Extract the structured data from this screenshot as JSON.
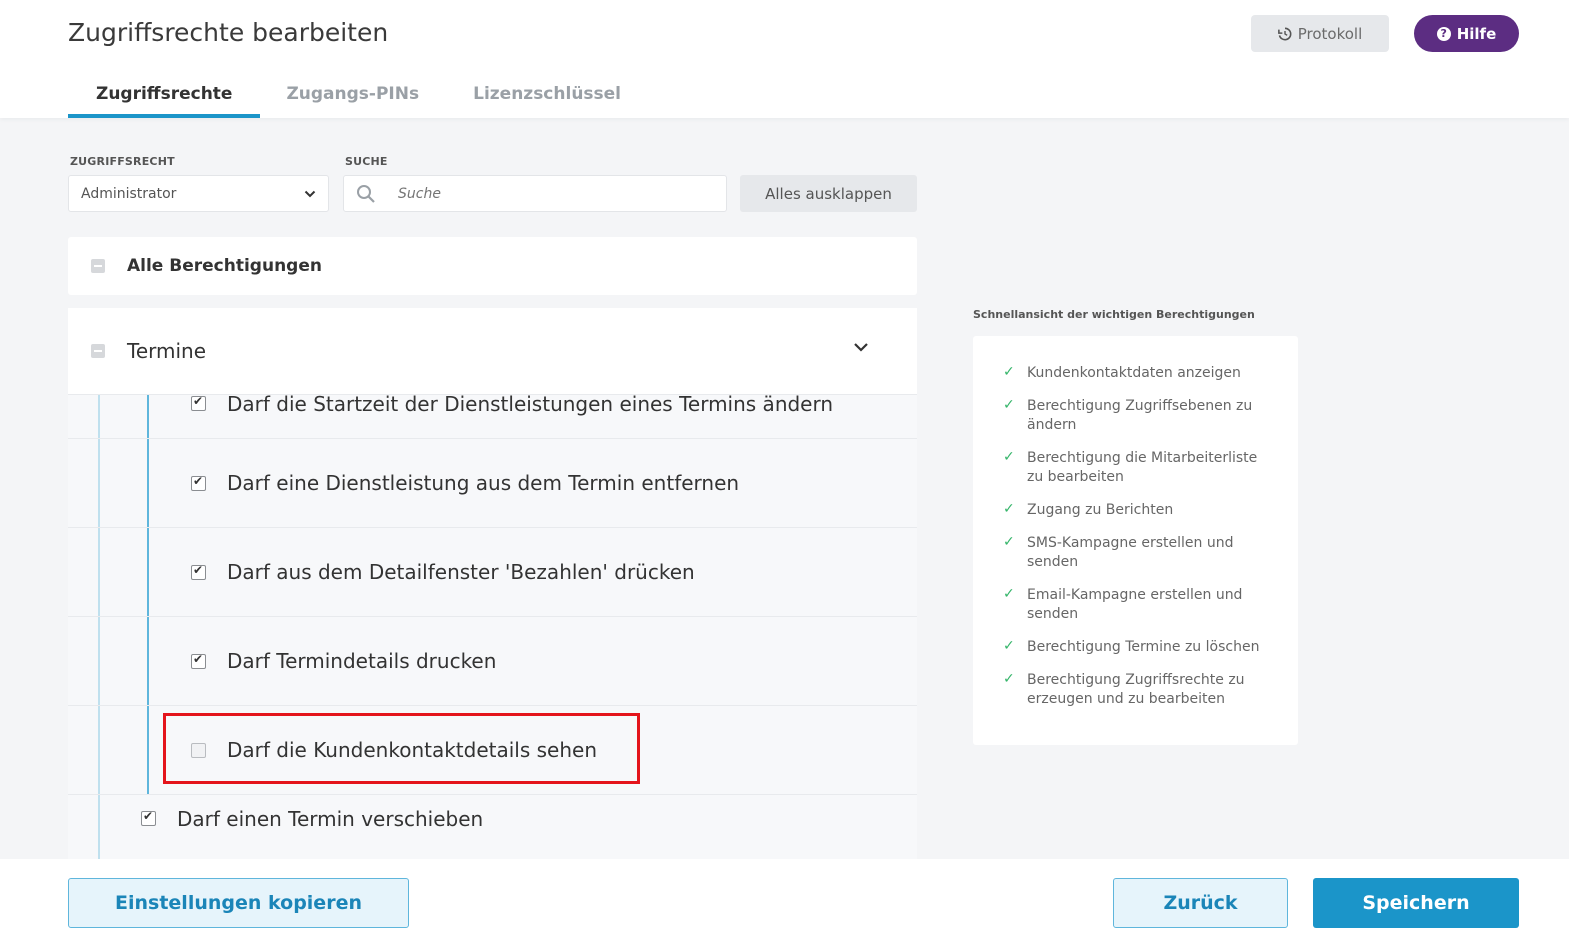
{
  "header": {
    "title": "Zugriffsrechte bearbeiten",
    "protokoll_label": "Protokoll",
    "hilfe_label": "Hilfe",
    "tabs": [
      "Zugriffsrechte",
      "Zugangs-PINs",
      "Lizenzschlüssel"
    ]
  },
  "filters": {
    "role_label": "ZUGRIFFSRECHT",
    "role_value": "Administrator",
    "search_label": "SUCHE",
    "search_placeholder": "Suche",
    "expand_all_label": "Alles ausklappen"
  },
  "permissions": {
    "all_label": "Alle Berechtigungen",
    "group_label": "Termine",
    "rows": [
      {
        "label": "Darf die Startzeit der Dienstleistungen eines Termins ändern",
        "checked": true
      },
      {
        "label": "Darf eine Dienstleistung aus dem Termin entfernen",
        "checked": true
      },
      {
        "label": "Darf aus dem Detailfenster 'Bezahlen' drücken",
        "checked": true
      },
      {
        "label": "Darf Termindetails drucken",
        "checked": true
      },
      {
        "label": "Darf die Kundenkontaktdetails sehen",
        "checked": false
      },
      {
        "label": "Darf einen Termin verschieben",
        "checked": true
      }
    ]
  },
  "quick_view": {
    "title": "Schnellansicht der wichtigen Berechtigungen",
    "items": [
      "Kundenkontaktdaten anzeigen",
      "Berechtigung Zugriffsebenen zu ändern",
      "Berechtigung die Mitarbeiterliste zu bearbeiten",
      "Zugang zu Berichten",
      "SMS-Kampagne erstellen und senden",
      "Email-Kampagne erstellen und senden",
      "Berechtigung Termine zu löschen",
      "Berechtigung Zugriffsrechte zu erzeugen und zu bearbeiten"
    ]
  },
  "footer": {
    "copy_label": "Einstellungen kopieren",
    "back_label": "Zurück",
    "save_label": "Speichern"
  },
  "colors": {
    "accent": "#1b95c9",
    "brand_purple": "#5c2d82",
    "highlight_red": "#e4141b",
    "check_green": "#35b56a"
  }
}
